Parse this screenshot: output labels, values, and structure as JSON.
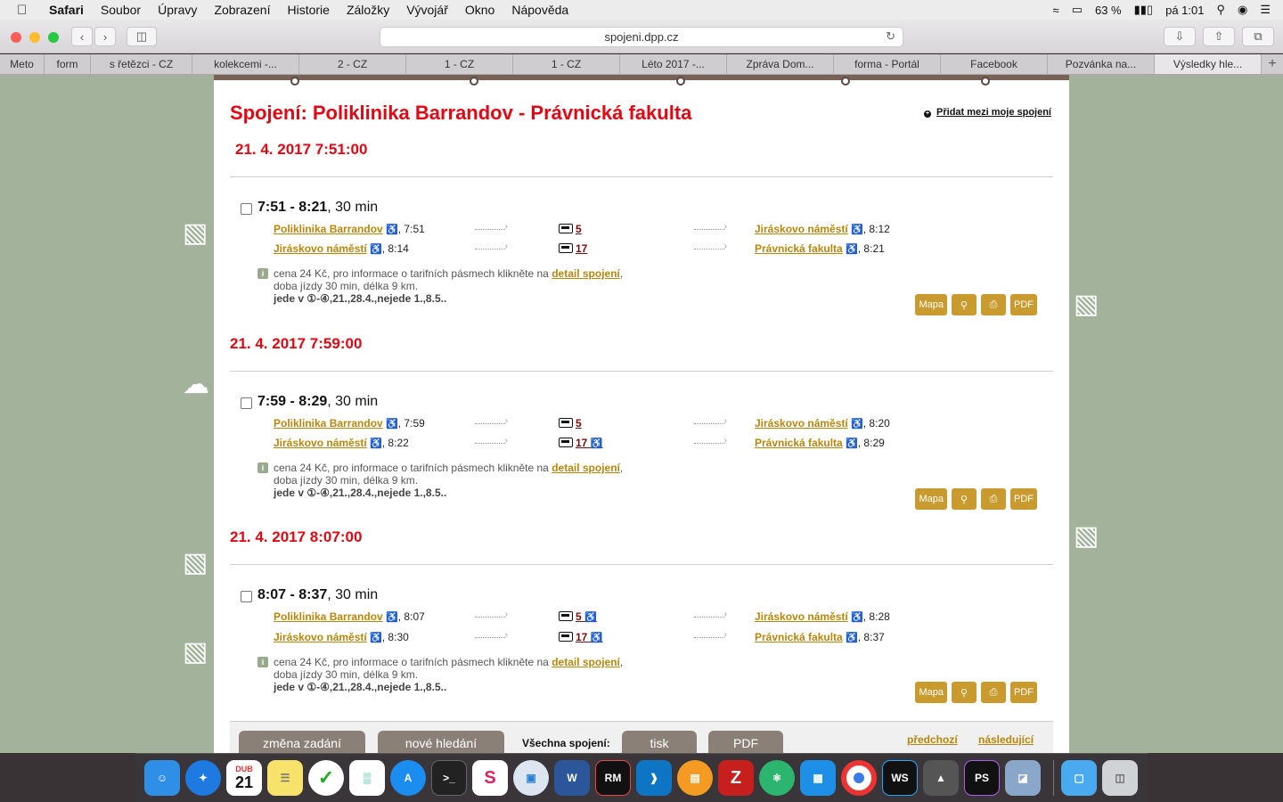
{
  "menubar": {
    "items": [
      "Safari",
      "Soubor",
      "Úpravy",
      "Zobrazení",
      "Historie",
      "Záložky",
      "Vývojář",
      "Okno",
      "Nápověda"
    ],
    "battery": "63 %",
    "clock": "pá 1:01"
  },
  "toolbar": {
    "url": "spojeni.dpp.cz"
  },
  "tabs": [
    {
      "label": "Meto",
      "w": 50
    },
    {
      "label": "form",
      "w": 52
    },
    {
      "label": "s řetězci - CZ",
      "w": 114
    },
    {
      "label": "kolekcemi -...",
      "w": 120
    },
    {
      "label": "2 - CZ",
      "w": 120
    },
    {
      "label": "1 - CZ",
      "w": 120
    },
    {
      "label": "1 - CZ",
      "w": 120
    },
    {
      "label": "Léto 2017 -...",
      "w": 120
    },
    {
      "label": "Zpráva Dom...",
      "w": 120
    },
    {
      "label": "forma - Portál",
      "w": 120
    },
    {
      "label": "Facebook",
      "w": 120
    },
    {
      "label": "Pozvánka na...",
      "w": 120
    },
    {
      "label": "Výsledky hle...",
      "w": 120
    }
  ],
  "page": {
    "title": "Spojení: Poliklinika Barrandov - Právnická fakulta",
    "add_favorite": "Přidat mezi moje spojení",
    "first_date": "21. 4. 2017 7:51:00"
  },
  "connections": [
    {
      "time": "7:51 - 8:21",
      "duration": ", 30 min",
      "legs": [
        {
          "from": "Poliklinika Barrandov",
          "dep": ", 7:51",
          "line": "5",
          "to": "Jiráskovo náměstí",
          "arr": ", 8:12"
        },
        {
          "from": "Jiráskovo náměstí",
          "dep": ", 8:14",
          "line": "17",
          "to": "Právnická fakulta",
          "arr": ", 8:21"
        }
      ],
      "info1": "cena 24 Kč, pro informace o tarifních pásmech klikněte na",
      "detail": "detail spojení",
      "info2": "doba jízdy 30 min, délka 9 km.",
      "runs": "jede v ①-④,21.,28.4.,nejede 1.,8.5.."
    },
    {
      "date_before": "21. 4. 2017 7:59:00",
      "time": "7:59 - 8:29",
      "duration": ", 30 min",
      "legs": [
        {
          "from": "Poliklinika Barrandov",
          "dep": ", 7:59",
          "line": "5",
          "to": "Jiráskovo náměstí",
          "arr": ", 8:20"
        },
        {
          "from": "Jiráskovo náměstí",
          "dep": ", 8:22",
          "line": "17",
          "to": "Právnická fakulta",
          "arr": ", 8:29"
        }
      ],
      "info1": "cena 24 Kč, pro informace o tarifních pásmech klikněte na",
      "detail": "detail spojení",
      "info2": "doba jízdy 30 min, délka 9 km.",
      "runs": "jede v ①-④,21.,28.4.,nejede 1.,8.5.."
    },
    {
      "date_before": "21. 4. 2017 8:07:00",
      "time": "8:07 - 8:37",
      "duration": ", 30 min",
      "legs": [
        {
          "from": "Poliklinika Barrandov",
          "dep": ", 8:07",
          "line": "5",
          "to": "Jiráskovo náměstí",
          "arr": ", 8:28"
        },
        {
          "from": "Jiráskovo náměstí",
          "dep": ", 8:30",
          "line": "17",
          "to": "Právnická fakulta",
          "arr": ", 8:37"
        }
      ],
      "info1": "cena 24 Kč, pro informace o tarifních pásmech klikněte na",
      "detail": "detail spojení",
      "info2": "doba jízdy 30 min, délka 9 km.",
      "runs": "jede v ①-④,21.,28.4.,nejede 1.,8.5.."
    }
  ],
  "actions": {
    "map": "Mapa",
    "pdf": "PDF"
  },
  "bottom": {
    "change": "změna zadání",
    "new_search": "nové hledání",
    "all_conn": "Všechna spojení:",
    "print": "tisk",
    "pdf": "PDF",
    "prev": "předchozí",
    "next": "následující"
  },
  "dock": {
    "calendar_month": "DUB",
    "calendar_day": "21",
    "apps": [
      "finder-icon",
      "safari-icon",
      "calendar-icon",
      "notes-icon",
      "wunderlist-icon",
      "numbers-icon",
      "app-store-icon",
      "terminal-icon",
      "slack-icon",
      "remote-desktop-icon",
      "word-icon",
      "rubymine-icon",
      "vscode-icon",
      "ibooks-icon",
      "filezilla-icon",
      "atom-icon",
      "docker-icon",
      "chrome-icon",
      "webstorm-icon",
      "inkscape-icon",
      "phpstorm-icon",
      "preview-icon"
    ]
  }
}
